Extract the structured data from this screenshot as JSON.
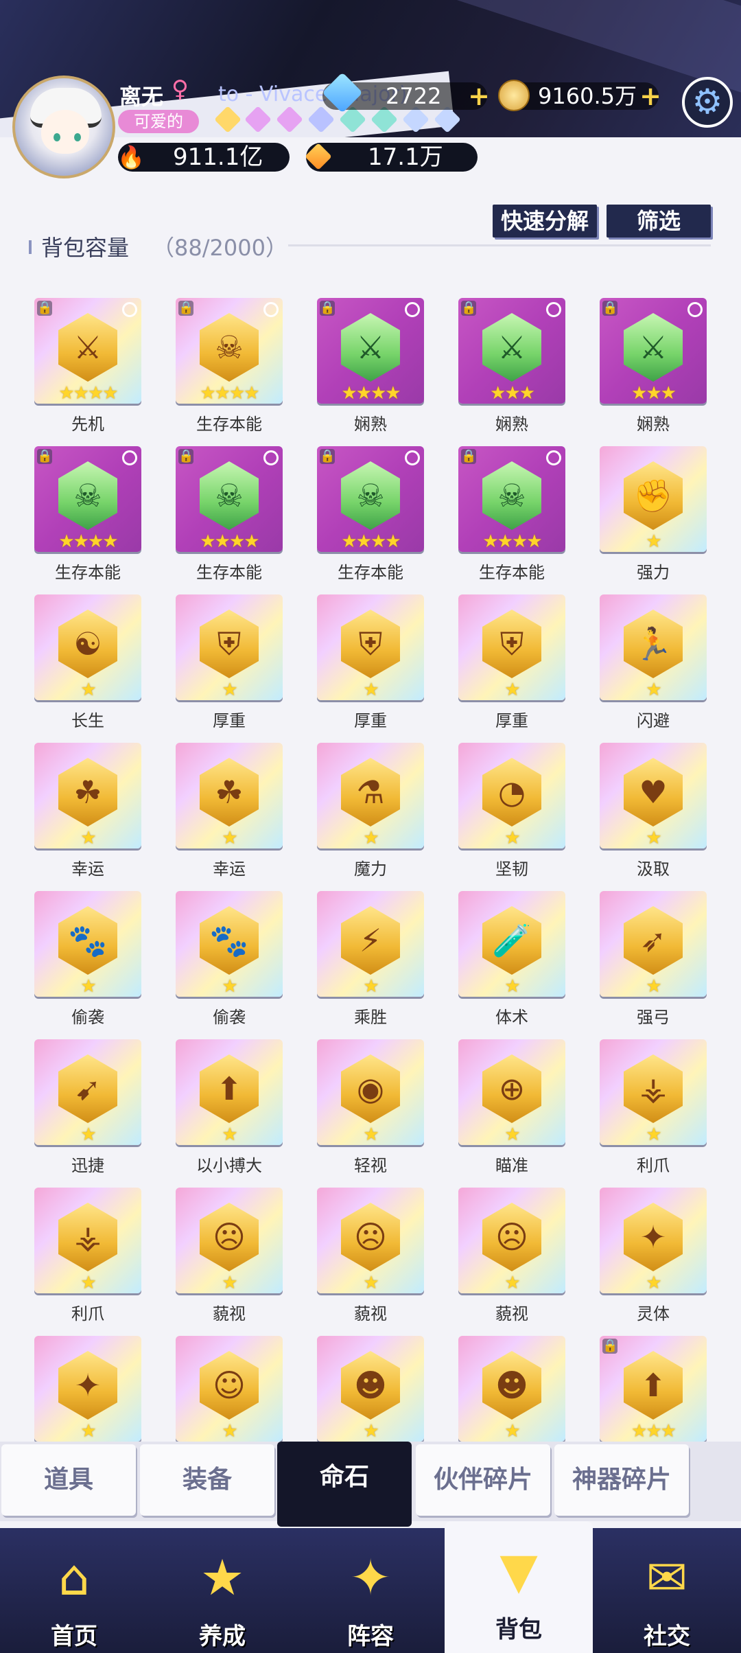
{
  "header": {
    "player_name": "离无",
    "gender_symbol": "♀",
    "title_badge": "可爱的",
    "song_text": "to - Vivace (Major)",
    "diamonds": "2722",
    "gold": "9160.5万",
    "power": "911.1亿",
    "stardust": "17.1万",
    "plus_symbol": "+",
    "settings_icon": "gear-icon"
  },
  "toolbar": {
    "quick_decompose": "快速分解",
    "filter": "筛选",
    "capacity_label": "背包容量",
    "capacity_value": "（88/2000）"
  },
  "items": [
    {
      "name": "先机",
      "stars": "★★★★",
      "rarity": "gold",
      "icon": "sword-icon",
      "glyph": "⚔",
      "locked": true,
      "selectable": true
    },
    {
      "name": "生存本能",
      "stars": "★★★★",
      "rarity": "gold",
      "icon": "skull-icon",
      "glyph": "☠",
      "locked": true,
      "selectable": true
    },
    {
      "name": "娴熟",
      "stars": "★★★★",
      "rarity": "purple",
      "icon": "sword-icon",
      "glyph": "⚔",
      "locked": true,
      "selectable": true
    },
    {
      "name": "娴熟",
      "stars": "★★★",
      "rarity": "purple",
      "icon": "sword-icon",
      "glyph": "⚔",
      "locked": true,
      "selectable": true
    },
    {
      "name": "娴熟",
      "stars": "★★★",
      "rarity": "purple",
      "icon": "sword-icon",
      "glyph": "⚔",
      "locked": true,
      "selectable": true
    },
    {
      "name": "生存本能",
      "stars": "★★★★",
      "rarity": "purple",
      "icon": "skull-icon",
      "glyph": "☠",
      "locked": true,
      "selectable": true
    },
    {
      "name": "生存本能",
      "stars": "★★★★",
      "rarity": "purple",
      "icon": "skull-icon",
      "glyph": "☠",
      "locked": true,
      "selectable": true
    },
    {
      "name": "生存本能",
      "stars": "★★★★",
      "rarity": "purple",
      "icon": "skull-icon",
      "glyph": "☠",
      "locked": true,
      "selectable": true
    },
    {
      "name": "生存本能",
      "stars": "★★★★",
      "rarity": "purple",
      "icon": "skull-icon",
      "glyph": "☠",
      "locked": true,
      "selectable": true
    },
    {
      "name": "强力",
      "stars": "★",
      "rarity": "gold",
      "icon": "fist-icon",
      "glyph": "✊",
      "locked": false,
      "selectable": false
    },
    {
      "name": "长生",
      "stars": "★",
      "rarity": "gold",
      "icon": "yin-yang-icon",
      "glyph": "☯",
      "locked": false,
      "selectable": false
    },
    {
      "name": "厚重",
      "stars": "★",
      "rarity": "gold",
      "icon": "shield-icon",
      "glyph": "⛨",
      "locked": false,
      "selectable": false
    },
    {
      "name": "厚重",
      "stars": "★",
      "rarity": "gold",
      "icon": "shield-icon",
      "glyph": "⛨",
      "locked": false,
      "selectable": false
    },
    {
      "name": "厚重",
      "stars": "★",
      "rarity": "gold",
      "icon": "shield-icon",
      "glyph": "⛨",
      "locked": false,
      "selectable": false
    },
    {
      "name": "闪避",
      "stars": "★",
      "rarity": "gold",
      "icon": "running-icon",
      "glyph": "🏃",
      "locked": false,
      "selectable": false
    },
    {
      "name": "幸运",
      "stars": "★",
      "rarity": "gold",
      "icon": "clover-icon",
      "glyph": "☘",
      "locked": false,
      "selectable": false
    },
    {
      "name": "幸运",
      "stars": "★",
      "rarity": "gold",
      "icon": "clover-icon",
      "glyph": "☘",
      "locked": false,
      "selectable": false
    },
    {
      "name": "魔力",
      "stars": "★",
      "rarity": "gold",
      "icon": "potion-icon",
      "glyph": "⚗",
      "locked": false,
      "selectable": false
    },
    {
      "name": "坚韧",
      "stars": "★",
      "rarity": "gold",
      "icon": "gauge-icon",
      "glyph": "◔",
      "locked": false,
      "selectable": false
    },
    {
      "name": "汲取",
      "stars": "★",
      "rarity": "gold",
      "icon": "lips-icon",
      "glyph": "♥",
      "locked": false,
      "selectable": false
    },
    {
      "name": "偷袭",
      "stars": "★",
      "rarity": "gold",
      "icon": "paw-icon",
      "glyph": "🐾",
      "locked": false,
      "selectable": false
    },
    {
      "name": "偷袭",
      "stars": "★",
      "rarity": "gold",
      "icon": "paw-icon",
      "glyph": "🐾",
      "locked": false,
      "selectable": false
    },
    {
      "name": "乘胜",
      "stars": "★",
      "rarity": "gold",
      "icon": "heart-bolt-icon",
      "glyph": "⚡",
      "locked": false,
      "selectable": false
    },
    {
      "name": "体术",
      "stars": "★",
      "rarity": "gold",
      "icon": "test-tube-icon",
      "glyph": "🧪",
      "locked": false,
      "selectable": false
    },
    {
      "name": "强弓",
      "stars": "★",
      "rarity": "gold",
      "icon": "arrows-icon",
      "glyph": "➶",
      "locked": false,
      "selectable": false
    },
    {
      "name": "迅捷",
      "stars": "★",
      "rarity": "gold",
      "icon": "speed-icon",
      "glyph": "➹",
      "locked": false,
      "selectable": false
    },
    {
      "name": "以小搏大",
      "stars": "★",
      "rarity": "gold",
      "icon": "arrow-up-icon",
      "glyph": "⬆",
      "locked": false,
      "selectable": false
    },
    {
      "name": "轻视",
      "stars": "★",
      "rarity": "gold",
      "icon": "eye-shield-icon",
      "glyph": "◉",
      "locked": false,
      "selectable": false
    },
    {
      "name": "瞄准",
      "stars": "★",
      "rarity": "gold",
      "icon": "crosshair-icon",
      "glyph": "⊕",
      "locked": false,
      "selectable": false
    },
    {
      "name": "利爪",
      "stars": "★",
      "rarity": "gold",
      "icon": "claw-icon",
      "glyph": "⚶",
      "locked": false,
      "selectable": false
    },
    {
      "name": "利爪",
      "stars": "★",
      "rarity": "gold",
      "icon": "claw-icon",
      "glyph": "⚶",
      "locked": false,
      "selectable": false
    },
    {
      "name": "藐视",
      "stars": "★",
      "rarity": "gold",
      "icon": "mask-icon",
      "glyph": "☹",
      "locked": false,
      "selectable": false
    },
    {
      "name": "藐视",
      "stars": "★",
      "rarity": "gold",
      "icon": "mask-icon",
      "glyph": "☹",
      "locked": false,
      "selectable": false
    },
    {
      "name": "藐视",
      "stars": "★",
      "rarity": "gold",
      "icon": "mask-icon",
      "glyph": "☹",
      "locked": false,
      "selectable": false
    },
    {
      "name": "灵体",
      "stars": "★",
      "rarity": "gold",
      "icon": "spirit-icon",
      "glyph": "✦",
      "locked": false,
      "selectable": false
    },
    {
      "name": "",
      "stars": "★",
      "rarity": "gold",
      "icon": "spirit-icon",
      "glyph": "✦",
      "locked": false,
      "selectable": false
    },
    {
      "name": "",
      "stars": "★",
      "rarity": "gold",
      "icon": "halo-icon",
      "glyph": "☺",
      "locked": false,
      "selectable": false
    },
    {
      "name": "",
      "stars": "★",
      "rarity": "gold",
      "icon": "demon-icon",
      "glyph": "☻",
      "locked": false,
      "selectable": false
    },
    {
      "name": "",
      "stars": "★",
      "rarity": "gold",
      "icon": "demon-icon",
      "glyph": "☻",
      "locked": false,
      "selectable": false
    },
    {
      "name": "",
      "stars": "★★★",
      "rarity": "gold",
      "icon": "magic-circle-icon",
      "glyph": "⬆",
      "locked": true,
      "selectable": false
    }
  ],
  "subtabs": [
    {
      "label": "道具",
      "active": false
    },
    {
      "label": "装备",
      "active": false
    },
    {
      "label": "命石",
      "active": true
    },
    {
      "label": "伙伴碎片",
      "active": false
    },
    {
      "label": "神器碎片",
      "active": false
    }
  ],
  "bottom_nav": [
    {
      "label": "首页",
      "icon": "home-icon",
      "glyph": "⌂",
      "active": false
    },
    {
      "label": "养成",
      "icon": "star-icon",
      "glyph": "★",
      "active": false
    },
    {
      "label": "阵容",
      "icon": "compass-star-icon",
      "glyph": "✦",
      "active": false
    },
    {
      "label": "背包",
      "icon": "backpack-icon",
      "glyph": "▼",
      "active": true
    },
    {
      "label": "社交",
      "icon": "chat-icon",
      "glyph": "✉",
      "active": false
    }
  ],
  "colors": {
    "accent_gold": "#ffd52a",
    "header_bg": "#15172b",
    "nav_bg": "#1a1d3b"
  }
}
